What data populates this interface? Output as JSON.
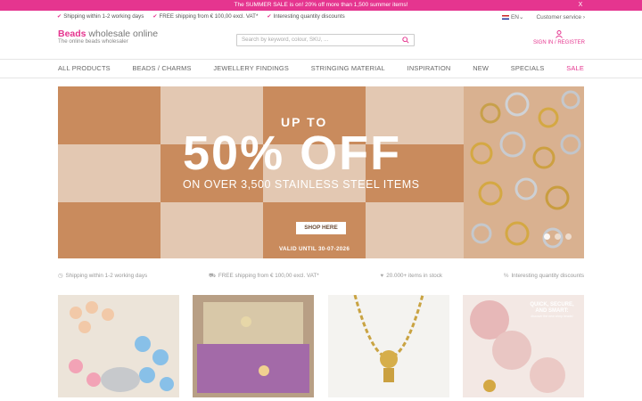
{
  "promo": {
    "text": "The SUMMER SALE is on! 20% off more than 1,500 summer items!",
    "close": "X"
  },
  "usp_top": [
    "Shipping within 1-2 working days",
    "FREE shipping from € 100,00 excl. VAT*",
    "Interesting quantity discounts"
  ],
  "top_right": {
    "language": "EN",
    "customer_service": "Customer service"
  },
  "logo": {
    "strong": "Beads",
    "rest": " wholesale online",
    "tagline": "The online beads wholesaler"
  },
  "search": {
    "placeholder": "Search by keyword, colour, SKU, ..."
  },
  "account": {
    "label": "SIGN IN / REGISTER"
  },
  "nav": [
    "ALL PRODUCTS",
    "BEADS / CHARMS",
    "JEWELLERY FINDINGS",
    "STRINGING MATERIAL",
    "INSPIRATION",
    "NEW",
    "SPECIALS",
    "SALE"
  ],
  "hero": {
    "line1": "UP TO",
    "line2": "50% OFF",
    "line3": "ON OVER 3,500 STAINLESS STEEL ITEMS",
    "button": "SHOP HERE",
    "valid": "VALID UNTIL 30-07-2026",
    "slide_count": 3
  },
  "usp_mid": [
    {
      "icon": "clock-icon",
      "text": "Shipping within 1-2 working days"
    },
    {
      "icon": "truck-icon",
      "text": "FREE shipping from € 100,00 excl. VAT*"
    },
    {
      "icon": "heart-icon",
      "text": "20.000+ items in stock"
    },
    {
      "icon": "percent-icon",
      "text": "Interesting quantity discounts"
    }
  ],
  "cards": {
    "card4": {
      "title": "QUICK, SECURE, AND SMART:",
      "sub": "discover the new crimp beads!"
    }
  },
  "colors": {
    "brand": "#e5358f",
    "hero_tan": "#c98b5d",
    "hero_dark": "#b8774a"
  }
}
